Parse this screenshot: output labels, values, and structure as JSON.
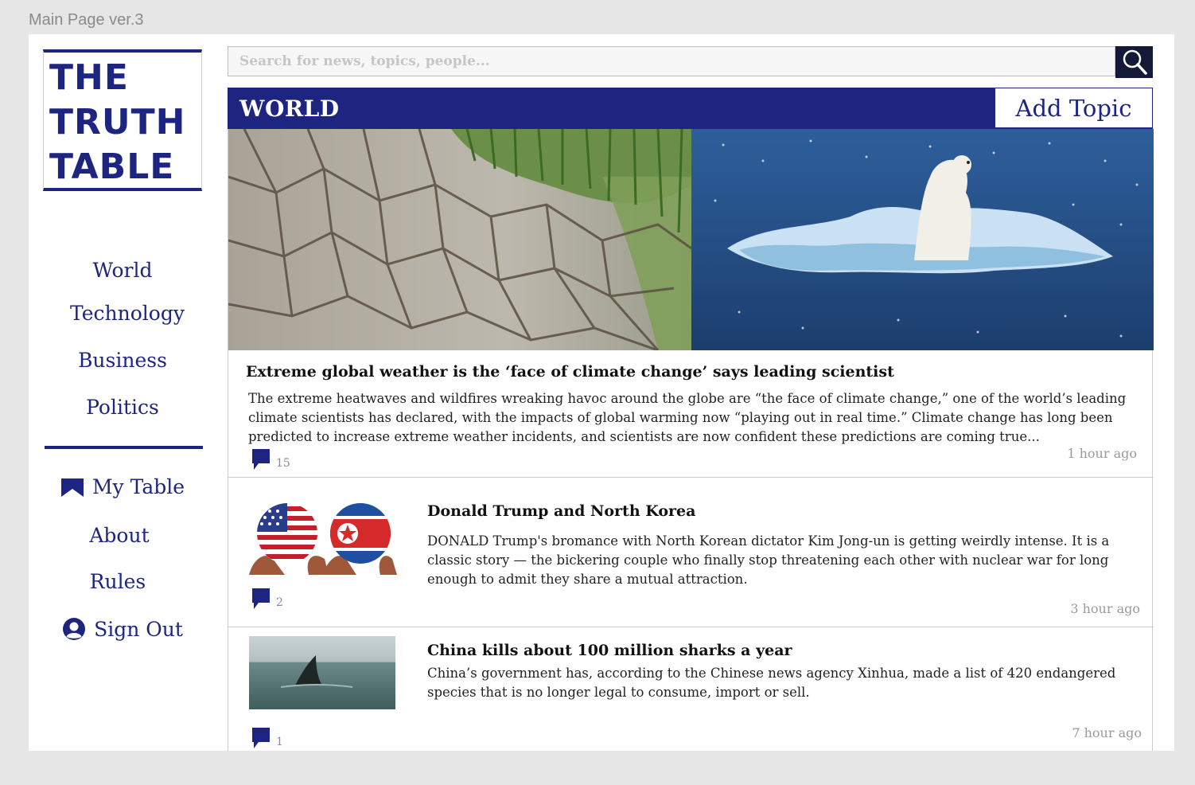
{
  "frame_label": "Main Page ver.3",
  "logo": {
    "line1": "THE",
    "line2": "TRUTH",
    "line3": "TABLE"
  },
  "nav": {
    "world": "World",
    "technology": "Technology",
    "business": "Business",
    "politics": "Politics",
    "my_table": "My Table",
    "about": "About",
    "rules": "Rules",
    "sign_out": "Sign Out"
  },
  "search": {
    "placeholder": "Search for news, topics, people..."
  },
  "section": {
    "title": "WORLD",
    "add_topic": "Add Topic"
  },
  "articles": [
    {
      "headline": "Extreme global weather is the ‘face of climate change’ says leading scientist",
      "summary": "The extreme heatwaves and wildfires wreaking havoc around the globe are “the face of climate change,” one of the world’s leading climate scientists has declared, with the impacts of global warming now “playing out in real time.” Climate change has long been predicted to increase extreme weather incidents, and scientists are now confident these predictions are coming true...",
      "comments": "15",
      "time": "1 hour ago"
    },
    {
      "headline": "Donald Trump and North Korea",
      "summary": "DONALD Trump's bromance with North Korean dictator Kim Jong-un is getting weirdly intense. It is a classic story — the bickering couple who finally stop threatening each other with nuclear war for long enough to admit they share a mutual attraction.",
      "comments": "2",
      "time": "3 hour ago"
    },
    {
      "headline": "China kills about 100 million sharks a year",
      "summary": "China’s government has, according to the Chinese news agency Xinhua, made a list of 420 endangered species that is no longer legal to consume, import or sell.",
      "comments": "1",
      "time": "7 hour ago"
    }
  ],
  "colors": {
    "brand": "#1d2580",
    "search_button": "#141a36",
    "muted": "#9a9a9a"
  }
}
